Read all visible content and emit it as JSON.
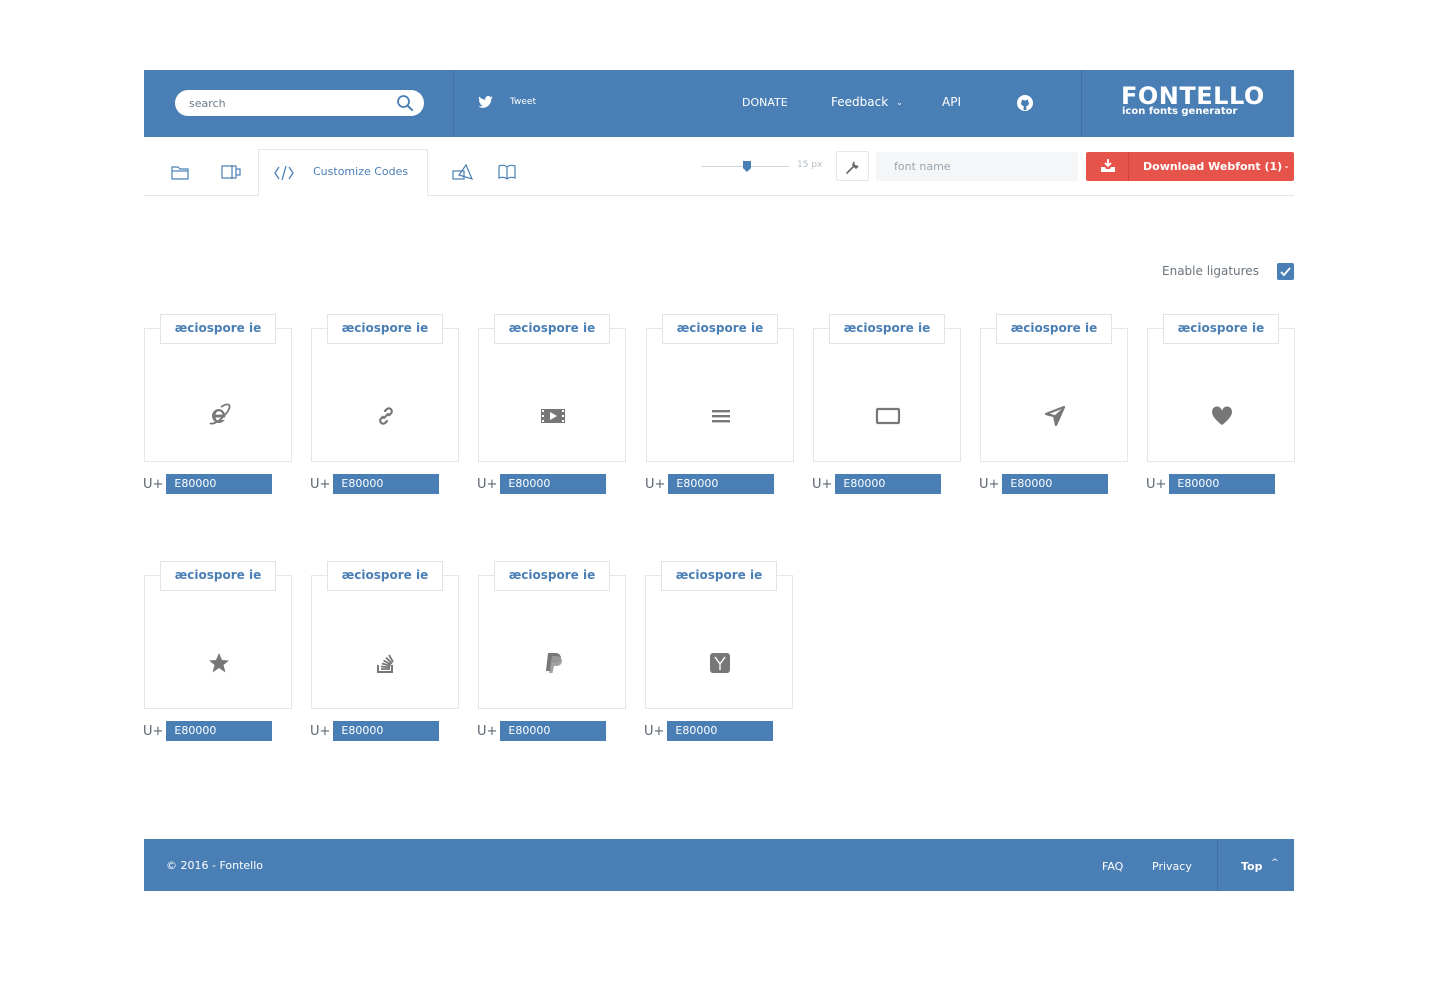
{
  "header": {
    "search_placeholder": "search",
    "tweet_label": "Tweet",
    "nav": {
      "donate": "DONATE",
      "feedback": "Feedback",
      "api": "API"
    },
    "logo_title": "FONTELLO",
    "logo_subtitle": "icon fonts generator"
  },
  "toolbar": {
    "active_tab_label": "Customize Codes",
    "size_label": "15 px",
    "size_value": 15,
    "font_name_placeholder": "font name",
    "download_label": "Download Webfont (1)"
  },
  "ligatures": {
    "label": "Enable ligatures",
    "enabled": true
  },
  "glyphs": [
    {
      "name": "æciospore ie",
      "icon": "internet-explorer-icon",
      "code_prefix": "U+",
      "code": "E80000"
    },
    {
      "name": "æciospore ie",
      "icon": "link-icon",
      "code_prefix": "U+",
      "code": "E80000"
    },
    {
      "name": "æciospore ie",
      "icon": "video-icon",
      "code_prefix": "U+",
      "code": "E80000"
    },
    {
      "name": "æciospore ie",
      "icon": "menu-icon",
      "code_prefix": "U+",
      "code": "E80000"
    },
    {
      "name": "æciospore ie",
      "icon": "rectangle-icon",
      "code_prefix": "U+",
      "code": "E80000"
    },
    {
      "name": "æciospore ie",
      "icon": "navigation-icon",
      "code_prefix": "U+",
      "code": "E80000"
    },
    {
      "name": "æciospore ie",
      "icon": "heart-icon",
      "code_prefix": "U+",
      "code": "E80000"
    },
    {
      "name": "æciospore ie",
      "icon": "star-icon",
      "code_prefix": "U+",
      "code": "E80000"
    },
    {
      "name": "æciospore ie",
      "icon": "stackoverflow-icon",
      "code_prefix": "U+",
      "code": "E80000"
    },
    {
      "name": "æciospore ie",
      "icon": "paypal-icon",
      "code_prefix": "U+",
      "code": "E80000"
    },
    {
      "name": "æciospore ie",
      "icon": "hacker-news-icon",
      "code_prefix": "U+",
      "code": "E80000"
    }
  ],
  "footer": {
    "copyright": "© 2016 - Fontello",
    "faq": "FAQ",
    "privacy": "Privacy",
    "top": "Top"
  },
  "colors": {
    "brand": "#4a7fb5",
    "download": "#e5534b",
    "glyph_icon": "#777777"
  }
}
